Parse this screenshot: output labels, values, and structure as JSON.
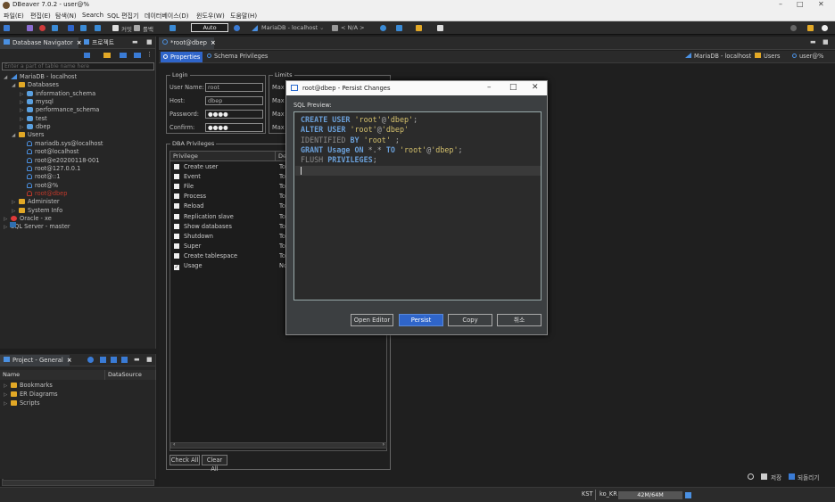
{
  "window": {
    "title": "DBeaver 7.0.2 - user@%",
    "min": "–",
    "max": "□",
    "close": "✕"
  },
  "menu": [
    "파일(E)",
    "편집(E)",
    "탐색(N)",
    "Search",
    "SQL 편집기",
    "데이터베이스(D)",
    "윈도우(W)",
    "도움말(H)"
  ],
  "toolbar": {
    "commit_label": "커밋",
    "rollback_label": "롤백",
    "transaction_mode": "Auto",
    "active_connection": "MariaDB - localhost",
    "active_schema": "< N/A >"
  },
  "navigator": {
    "tab_label": "Database Navigator",
    "other_tab": "프로젝트",
    "filter_placeholder": "Enter a part of table name here",
    "tree": [
      {
        "label": "MariaDB - localhost",
        "level": 0,
        "icon": "connection-icon",
        "expanded": true
      },
      {
        "label": "Databases",
        "level": 1,
        "icon": "folder-icon",
        "expanded": true
      },
      {
        "label": "information_schema",
        "level": 2,
        "icon": "database-icon"
      },
      {
        "label": "mysql",
        "level": 2,
        "icon": "database-icon"
      },
      {
        "label": "performance_schema",
        "level": 2,
        "icon": "database-icon"
      },
      {
        "label": "test",
        "level": 2,
        "icon": "database-icon"
      },
      {
        "label": "dbep",
        "level": 2,
        "icon": "database-icon"
      },
      {
        "label": "Users",
        "level": 1,
        "icon": "folder-icon",
        "expanded": true
      },
      {
        "label": "mariadb.sys@localhost",
        "level": 2,
        "icon": "user-icon"
      },
      {
        "label": "root@localhost",
        "level": 2,
        "icon": "user-icon"
      },
      {
        "label": "root@e20200118-001",
        "level": 2,
        "icon": "user-icon"
      },
      {
        "label": "root@127.0.0.1",
        "level": 2,
        "icon": "user-icon"
      },
      {
        "label": "root@::1",
        "level": 2,
        "icon": "user-icon"
      },
      {
        "label": "root@%",
        "level": 2,
        "icon": "user-icon"
      },
      {
        "label": "root@dbep",
        "level": 2,
        "icon": "user-icon",
        "color": "#c0392b"
      },
      {
        "label": "Administer",
        "level": 1,
        "icon": "folder-icon"
      },
      {
        "label": "System Info",
        "level": 1,
        "icon": "folder-icon"
      },
      {
        "label": "Oracle - xe",
        "level": 0,
        "icon": "oracle-icon"
      },
      {
        "label": "SQL Server - master",
        "level": 0,
        "icon": "sqlserver-icon"
      }
    ]
  },
  "project": {
    "tab_label": "Project - General",
    "columns": [
      "Name",
      "DataSource"
    ],
    "items": [
      "Bookmarks",
      "ER Diagrams",
      "Scripts"
    ]
  },
  "editor": {
    "tab_label": "*root@dbep",
    "subtabs": [
      "Properties",
      "Schema Privileges"
    ],
    "breadcrumb": [
      "MariaDB - localhost",
      "Users",
      "user@%"
    ],
    "login": {
      "group": "Login",
      "fields": [
        {
          "label": "User Name:",
          "value": "root"
        },
        {
          "label": "Host:",
          "value": "dbep"
        },
        {
          "label": "Password:",
          "value": "●●●●"
        },
        {
          "label": "Confirm:",
          "value": "●●●●"
        }
      ]
    },
    "limits": {
      "group": "Limits",
      "rows": [
        "Max",
        "Max",
        "Max",
        "Max"
      ]
    },
    "privileges": {
      "group": "DBA Privileges",
      "columns": [
        "Privilege",
        "De"
      ],
      "rows": [
        {
          "name": "Create user",
          "desc": "To",
          "checked": false
        },
        {
          "name": "Event",
          "desc": "To",
          "checked": false
        },
        {
          "name": "File",
          "desc": "To",
          "checked": false
        },
        {
          "name": "Process",
          "desc": "To",
          "checked": false
        },
        {
          "name": "Reload",
          "desc": "To",
          "checked": false
        },
        {
          "name": "Replication slave",
          "desc": "To",
          "checked": false
        },
        {
          "name": "Show databases",
          "desc": "To",
          "checked": false
        },
        {
          "name": "Shutdown",
          "desc": "To",
          "checked": false
        },
        {
          "name": "Super",
          "desc": "To",
          "checked": false
        },
        {
          "name": "Create tablespace",
          "desc": "To",
          "checked": false
        },
        {
          "name": "Usage",
          "desc": "No",
          "checked": true
        }
      ],
      "check_all": "Check All",
      "clear_all": "Clear All"
    },
    "bottom_actions": {
      "save": "저장",
      "revert": "되돌리기"
    }
  },
  "dialog": {
    "title": "root@dbep - Persist Changes",
    "preview_label": "SQL Preview:",
    "sql_lines": [
      [
        {
          "t": "CREATE USER ",
          "c": "kw"
        },
        {
          "t": "'root'",
          "c": "str"
        },
        {
          "t": "@",
          "c": "plain"
        },
        {
          "t": "'dbep'",
          "c": "str"
        },
        {
          "t": ";",
          "c": "plain"
        }
      ],
      [
        {
          "t": "ALTER USER ",
          "c": "kw"
        },
        {
          "t": "'root'",
          "c": "str"
        },
        {
          "t": "@",
          "c": "plain"
        },
        {
          "t": "'dbep'",
          "c": "str"
        }
      ],
      [
        {
          "t": "IDENTIFIED ",
          "c": "dim"
        },
        {
          "t": "BY ",
          "c": "kw"
        },
        {
          "t": "'root'",
          "c": "str"
        },
        {
          "t": " ;",
          "c": "plain"
        }
      ],
      [
        {
          "t": "GRANT Usage ON ",
          "c": "kw"
        },
        {
          "t": "*.* ",
          "c": "plain"
        },
        {
          "t": "TO ",
          "c": "kw"
        },
        {
          "t": "'root'",
          "c": "str"
        },
        {
          "t": "@",
          "c": "plain"
        },
        {
          "t": "'dbep'",
          "c": "str"
        },
        {
          "t": ";",
          "c": "plain"
        }
      ],
      [
        {
          "t": "FLUSH ",
          "c": "dim"
        },
        {
          "t": "PRIVILEGES",
          "c": "kw"
        },
        {
          "t": ";",
          "c": "plain"
        }
      ]
    ],
    "buttons": [
      "Open Editor",
      "Persist",
      "Copy",
      "취소"
    ]
  },
  "status": {
    "timezone": "KST",
    "locale": "ko_KR",
    "memory": "42M/64M"
  },
  "colors": {
    "accent": "#2f65ca",
    "folder": "#e2a826",
    "user_icon": "#4a90e2",
    "highlight_user": "#c0392b"
  }
}
